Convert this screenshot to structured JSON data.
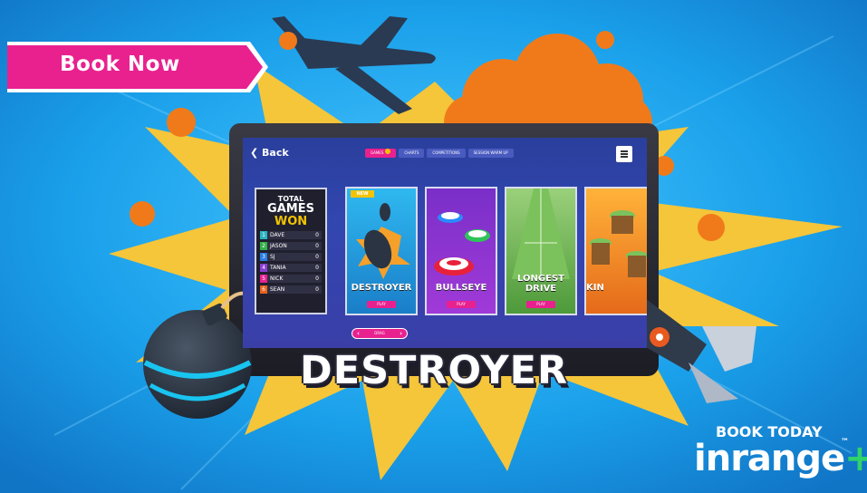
{
  "banner": {
    "book_now_label": "Book Now"
  },
  "screen": {
    "back_label": "Back",
    "tabs": [
      {
        "label": "GAMES",
        "active": true
      },
      {
        "label": "CHARTS",
        "active": false
      },
      {
        "label": "COMPETITIONS",
        "active": false
      },
      {
        "label": "SESSION WARM UP",
        "active": false
      }
    ],
    "leaderboard": {
      "title_line1": "TOTAL",
      "title_line2": "GAMES",
      "title_line3": "WON",
      "rows": [
        {
          "rank": "1",
          "name": "DAVE",
          "score": "0",
          "color": "#2bb3c0"
        },
        {
          "rank": "2",
          "name": "JASON",
          "score": "0",
          "color": "#33b04a"
        },
        {
          "rank": "3",
          "name": "SJ",
          "score": "0",
          "color": "#2a7de1"
        },
        {
          "rank": "4",
          "name": "TANIA",
          "score": "0",
          "color": "#8a3fd1"
        },
        {
          "rank": "5",
          "name": "NICK",
          "score": "0",
          "color": "#e8218f"
        },
        {
          "rank": "6",
          "name": "SEAN",
          "score": "0",
          "color": "#e8631c"
        }
      ]
    },
    "cards": [
      {
        "title": "DESTROYER",
        "play_label": "PLAY",
        "tag": "NEW"
      },
      {
        "title": "BULLSEYE",
        "play_label": "PLAY"
      },
      {
        "title": "LONGEST DRIVE",
        "play_label": "PLAY"
      },
      {
        "title": "KIN",
        "play_label": ""
      }
    ],
    "scroller_label": "DRAG"
  },
  "game_title": "DESTROYER",
  "promo": {
    "book_today": "BOOK TODAY",
    "brand": "inrange",
    "tm": "™"
  },
  "colors": {
    "sky": "#1a9be6",
    "pink": "#e8218f",
    "burst": "#f5c53a",
    "cloud": "#f07a1a"
  }
}
